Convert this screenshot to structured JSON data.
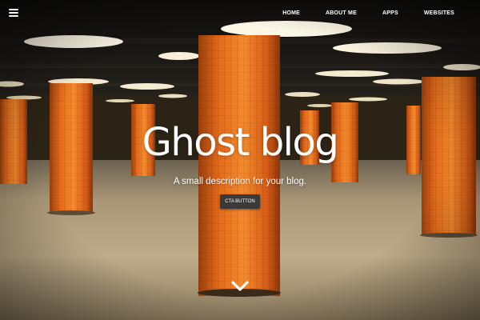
{
  "nav": {
    "menu_icon": "hamburger-menu-icon",
    "links": [
      "HOME",
      "ABOUT ME",
      "APPS",
      "WEBSITES"
    ]
  },
  "hero": {
    "title": "Ghost blog",
    "subtitle": "A small description for your blog.",
    "cta_label": "CTA BUTTON",
    "scroll_icon": "chevron-down-icon"
  },
  "colors": {
    "pillar_orange": "#e8721c",
    "ceiling_dark": "#141210",
    "floor": "#c9b695",
    "light_panel": "#fdf7e6",
    "button_bg": "#3a3a3a",
    "text": "#ffffff"
  }
}
